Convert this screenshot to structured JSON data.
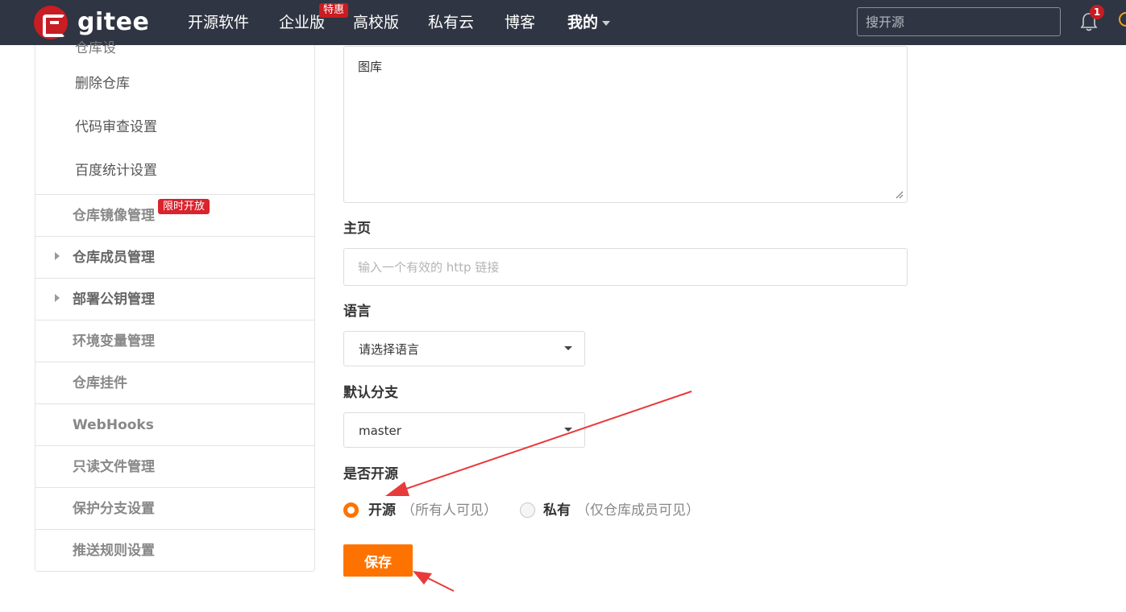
{
  "navbar": {
    "logo_text": "gitee",
    "items": [
      "开源软件",
      "企业版",
      "高校版",
      "私有云",
      "博客"
    ],
    "enterprise_badge": "特惠",
    "mine_label": "我的",
    "search_placeholder": "搜开源",
    "notification_count": "1"
  },
  "sidebar": {
    "sub_items": [
      "删除仓库",
      "代码审查设置",
      "百度统计设置"
    ],
    "rows": [
      {
        "label": "仓库镜像管理",
        "badge": "限时开放"
      },
      {
        "label": "仓库成员管理"
      },
      {
        "label": "部署公钥管理"
      },
      {
        "label": "环境变量管理"
      },
      {
        "label": "仓库挂件"
      },
      {
        "label": "WebHooks"
      },
      {
        "label": "只读文件管理"
      },
      {
        "label": "保护分支设置"
      },
      {
        "label": "推送规则设置"
      }
    ]
  },
  "form": {
    "description_value": "图库",
    "homepage_label": "主页",
    "homepage_placeholder": "输入一个有效的 http 链接",
    "language_label": "语言",
    "language_value": "请选择语言",
    "branch_label": "默认分支",
    "branch_value": "master",
    "visibility_label": "是否开源",
    "open_label": "开源",
    "open_hint": "（所有人可见）",
    "private_label": "私有",
    "private_hint": "（仅仓库成员可见）",
    "save_label": "保存",
    "visibility_selected": "开源"
  },
  "colors": {
    "navbar_bg": "#2f3542",
    "brand_red": "#c71d23",
    "accent_orange": "#fe7300",
    "annotation_arrow": "#e83a3a"
  }
}
